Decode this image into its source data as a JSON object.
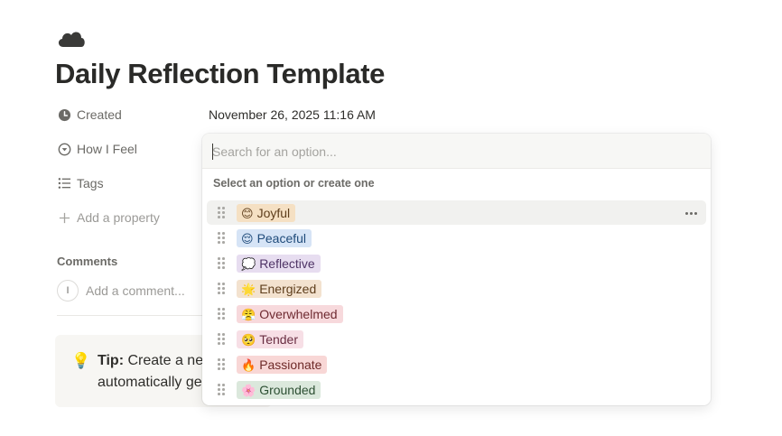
{
  "page": {
    "icon": "cloud-icon",
    "title": "Daily Reflection Template"
  },
  "properties": {
    "created": {
      "label": "Created",
      "icon": "clock-icon",
      "value": "November 26, 2025 11:16 AM"
    },
    "how_i_feel": {
      "label": "How I Feel",
      "icon": "select-circle-icon"
    },
    "tags": {
      "label": "Tags",
      "icon": "list-icon"
    },
    "add_property": {
      "label": "Add a property",
      "icon": "plus-icon"
    }
  },
  "comments": {
    "label": "Comments",
    "avatar_initial": "I",
    "placeholder": "Add a comment..."
  },
  "callout": {
    "icon": "💡",
    "bold": "Tip:",
    "line1": " Create a ne",
    "line2": "automatically ge"
  },
  "dropdown": {
    "search_placeholder": "Search for an option...",
    "hint": "Select an option or create one",
    "options": [
      {
        "emoji": "😊",
        "label": "Joyful",
        "bg": "#f5e0c3",
        "fg": "#5e3e1c"
      },
      {
        "emoji": "😌",
        "label": "Peaceful",
        "bg": "#d6e4f6",
        "fg": "#1f4b7a"
      },
      {
        "emoji": "💭",
        "label": "Reflective",
        "bg": "#e7ddf0",
        "fg": "#4f3466"
      },
      {
        "emoji": "🌟",
        "label": "Energized",
        "bg": "#f3e2cf",
        "fg": "#5e3e1c"
      },
      {
        "emoji": "😤",
        "label": "Overwhelmed",
        "bg": "#f7d9dc",
        "fg": "#6f2a31"
      },
      {
        "emoji": "🥺",
        "label": "Tender",
        "bg": "#f7dfe6",
        "fg": "#6a2f43"
      },
      {
        "emoji": "🔥",
        "label": "Passionate",
        "bg": "#f8d7d6",
        "fg": "#6e2a28"
      },
      {
        "emoji": "🌸",
        "label": "Grounded",
        "bg": "#dbe8dc",
        "fg": "#2e5034"
      }
    ]
  }
}
